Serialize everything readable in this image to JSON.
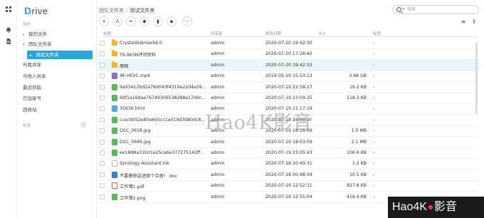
{
  "app": {
    "logo": "Drive",
    "logo_initial": "D"
  },
  "rail": {
    "icons": [
      "grid-icon",
      "bell-icon",
      "document-icon"
    ]
  },
  "sidebar": {
    "section_label": "我的",
    "items": [
      {
        "label": "我的文件",
        "caret": "▸"
      },
      {
        "label": "团队文件夹",
        "caret": "▾"
      },
      {
        "label": "测试文件夹",
        "caret": "▸"
      },
      {
        "label": "与我共享",
        "caret": ""
      },
      {
        "label": "与他人共享",
        "caret": ""
      },
      {
        "label": "最近存取",
        "caret": ""
      },
      {
        "label": "已加星号",
        "caret": ""
      },
      {
        "label": "回收站",
        "caret": ""
      }
    ],
    "tags_label": "标签",
    "add_tag": "+"
  },
  "breadcrumb": {
    "root": "团队文件夹",
    "sep": "/",
    "current": "测试文件夹"
  },
  "search": {
    "placeholder": "搜索",
    "dropdown": "▾"
  },
  "toolbar": {
    "buttons": [
      "+",
      "人",
      "⚭",
      "◆",
      "▮",
      "▪",
      "···"
    ]
  },
  "view": {
    "list_icon": "≡",
    "columns_icon": "⫴"
  },
  "table": {
    "headers": {
      "name": "标题",
      "owner": "所有者",
      "modified": "修改日期",
      "size": "大小",
      "tags": "标签"
    },
    "rows": [
      {
        "name": "Crystaldiskmark6.0",
        "type": "folder",
        "owner": "admin",
        "modified": "2020-07-20 19:42:30",
        "size": "",
        "tags": "-"
      },
      {
        "name": "TS-963N评测资料",
        "type": "folder",
        "owner": "admin",
        "modified": "2020-07-20 17:36:42",
        "size": "",
        "tags": "-"
      },
      {
        "name": "原图",
        "type": "folder",
        "owner": "admin",
        "modified": "2020-07-20 19:42:33",
        "size": "",
        "tags": "-"
      },
      {
        "name": "4K.HEVC.mp4",
        "type": "video",
        "owner": "admin",
        "modified": "2019-05-19 15:53:13",
        "size": "3.68 GB",
        "tags": "-"
      },
      {
        "name": "9a93412bd2a78d043f4319a22d4a59...",
        "type": "image",
        "owner": "admin",
        "modified": "2020-07-19 22:58:27",
        "size": "16.2 KB",
        "tags": "-"
      },
      {
        "name": "9df1a16dae76749306538288a17ddc...",
        "type": "image",
        "owner": "admin",
        "modified": "2020-07-19 23:09:25",
        "size": "118.3 KB",
        "tags": "-"
      },
      {
        "name": "35636.html",
        "type": "html",
        "owner": "admin",
        "modified": "2020-07-19 21:17:19",
        "size": "",
        "tags": "-"
      },
      {
        "name": "ccec9052e85e605cc1e019d3980dc8...",
        "type": "image",
        "owner": "admin",
        "modified": "2020-07-19 23:05:2?",
        "size": "",
        "tags": "-"
      },
      {
        "name": "DSC_0618.jpg",
        "type": "image",
        "owner": "admin",
        "modified": "2020-07-19 18:16:09",
        "size": "1.5 MB",
        "tags": "-"
      },
      {
        "name": "DSC_0649.jpg",
        "type": "image",
        "owner": "admin",
        "modified": "2020-07-19 18:03:09",
        "size": "2.1 MB",
        "tags": "-"
      },
      {
        "name": "ee1898a31b01e25ca6e377275142ff...",
        "type": "image",
        "owner": "admin",
        "modified": "2020-07-19 23:05:43",
        "size": "106.6 KB",
        "tags": "-"
      },
      {
        "name": "Synology Assistant.lnk",
        "type": "file",
        "owner": "admin",
        "modified": "2020-07-18 20:49:31",
        "size": "1.2 KB",
        "tags": "-"
      },
      {
        "name": "不要删除这进那个合夜！.doc",
        "type": "doc",
        "owner": "admin",
        "modified": "2020-07-18 00:48:59",
        "size": "10.5 KB",
        "tags": "-"
      },
      {
        "name": "工作簿1.pdf",
        "type": "pdf",
        "owner": "admin",
        "modified": "2020-07-19 12:52:31",
        "size": "827.8 KB",
        "tags": "-"
      },
      {
        "name": "工作簿1.png",
        "type": "image",
        "owner": "admin",
        "modified": "2020-07-19 12:55:04",
        "size": "416.4 KB",
        "tags": "-"
      }
    ]
  },
  "watermark": {
    "latin": "Hao4K",
    "zh": "影音"
  },
  "brand_badge": {
    "text_a": "Hao4K",
    "text_b": "影音"
  },
  "colors": {
    "accent": "#2aa5d9",
    "folder": "#f6b428",
    "highlight_row": "#eaf6f7"
  }
}
